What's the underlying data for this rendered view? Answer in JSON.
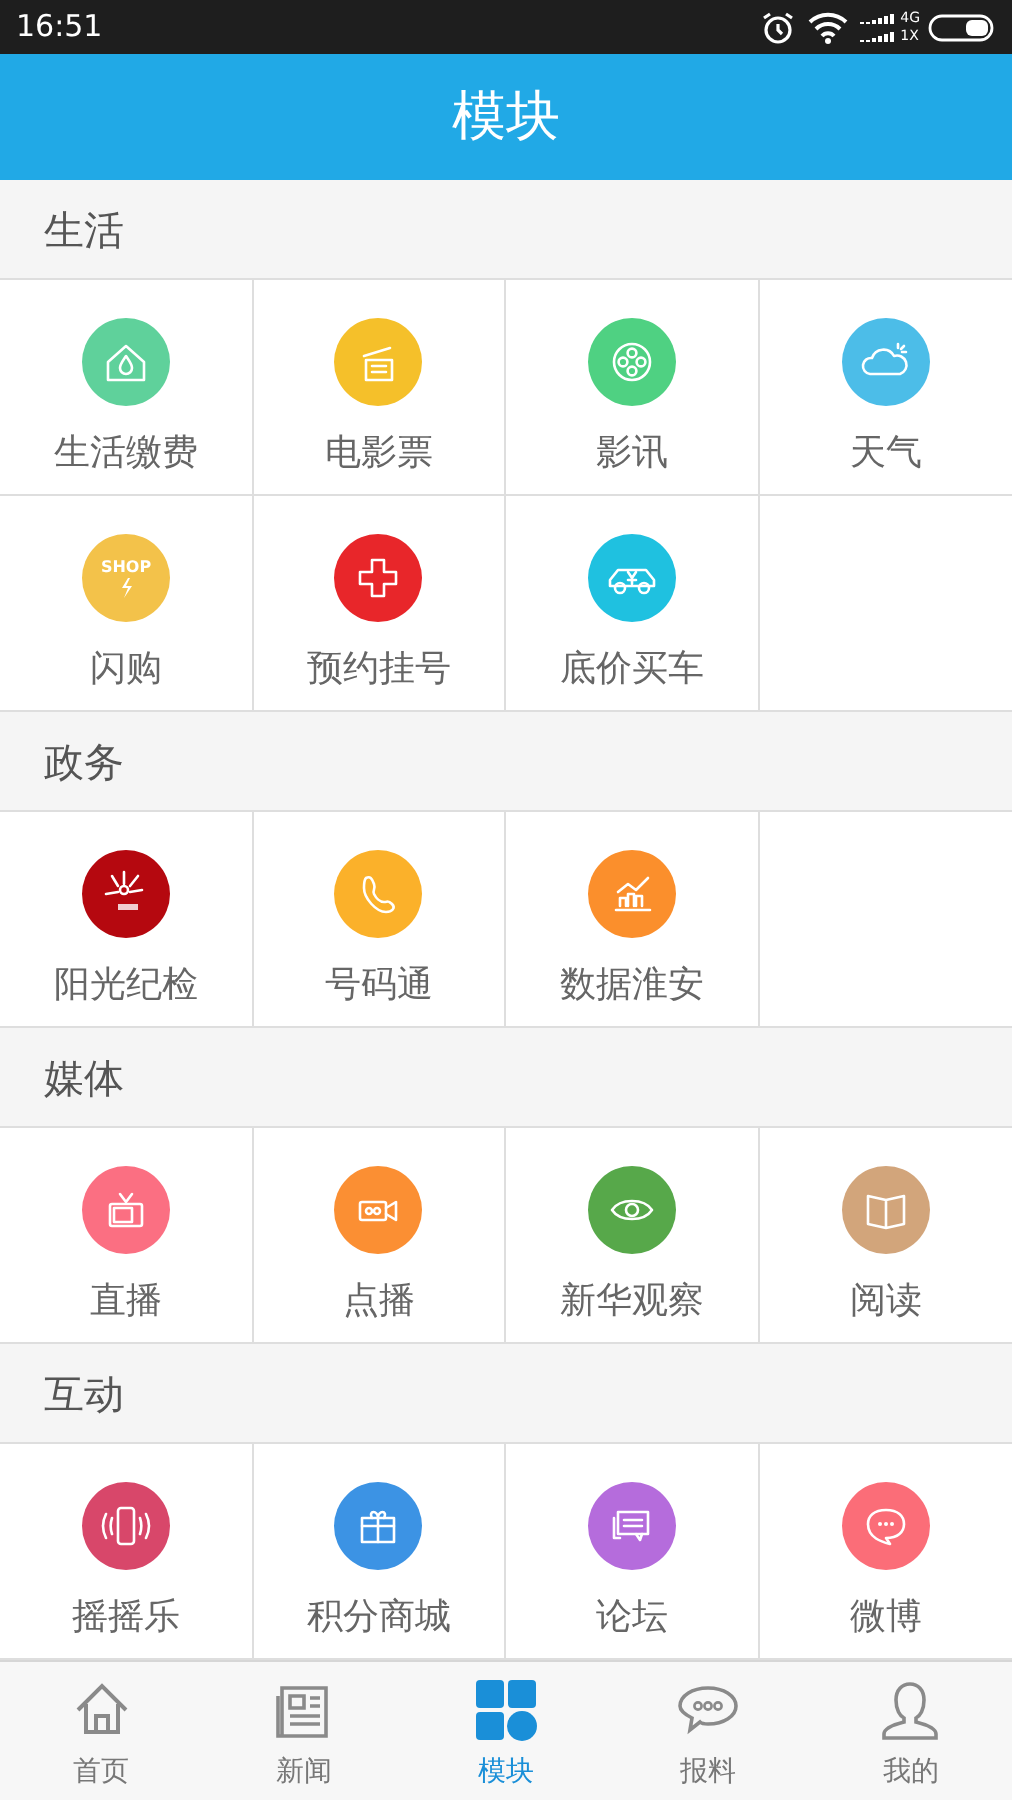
{
  "status_bar": {
    "time": "16:51",
    "network_top": "4G",
    "network_bottom": "1X"
  },
  "header": {
    "title": "模块"
  },
  "sections": [
    {
      "title": "生活",
      "items": [
        {
          "label": "生活缴费",
          "color": "#5fd19b"
        },
        {
          "label": "电影票",
          "color": "#f5c02a"
        },
        {
          "label": "影讯",
          "color": "#4fd182"
        },
        {
          "label": "天气",
          "color": "#4cbde8"
        },
        {
          "label": "闪购",
          "color": "#f3c24a",
          "badge": "SHOP"
        },
        {
          "label": "预约挂号",
          "color": "#e8262a"
        },
        {
          "label": "底价买车",
          "color": "#1fc1e0"
        }
      ]
    },
    {
      "title": "政务",
      "items": [
        {
          "label": "阳光纪检",
          "color": "#b5080f"
        },
        {
          "label": "号码通",
          "color": "#fbb12a"
        },
        {
          "label": "数据淮安",
          "color": "#fb8f2c"
        }
      ]
    },
    {
      "title": "媒体",
      "items": [
        {
          "label": "直播",
          "color": "#fb6f82"
        },
        {
          "label": "点播",
          "color": "#fb8f33"
        },
        {
          "label": "新华观察",
          "color": "#57a84a"
        },
        {
          "label": "阅读",
          "color": "#d2a57b"
        }
      ]
    },
    {
      "title": "互动",
      "items": [
        {
          "label": "摇摇乐",
          "color": "#d8476a"
        },
        {
          "label": "积分商城",
          "color": "#3c93e4"
        },
        {
          "label": "论坛",
          "color": "#b56cdc"
        },
        {
          "label": "微博",
          "color": "#fb6d78"
        }
      ]
    }
  ],
  "tabs": [
    {
      "label": "首页",
      "selected": false
    },
    {
      "label": "新闻",
      "selected": false
    },
    {
      "label": "模块",
      "selected": true
    },
    {
      "label": "报料",
      "selected": false
    },
    {
      "label": "我的",
      "selected": false
    }
  ]
}
